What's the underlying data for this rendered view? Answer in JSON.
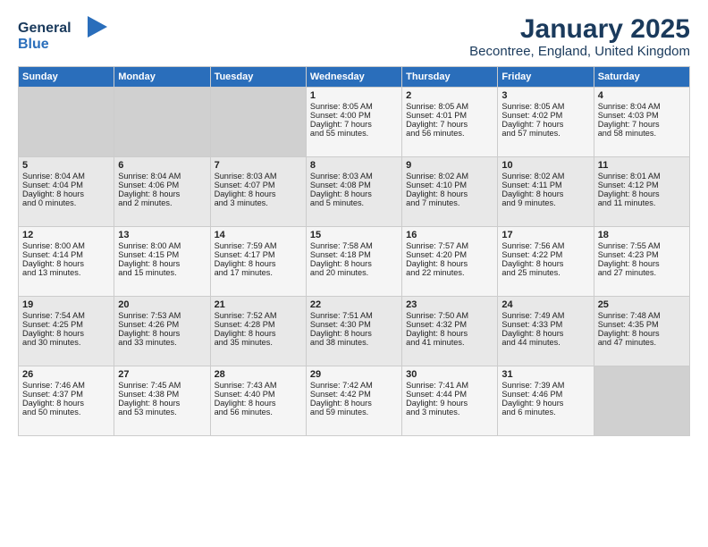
{
  "header": {
    "logo_line1": "General",
    "logo_line2": "Blue",
    "title": "January 2025",
    "subtitle": "Becontree, England, United Kingdom"
  },
  "days_of_week": [
    "Sunday",
    "Monday",
    "Tuesday",
    "Wednesday",
    "Thursday",
    "Friday",
    "Saturday"
  ],
  "weeks": [
    [
      {
        "day": "",
        "content": ""
      },
      {
        "day": "",
        "content": ""
      },
      {
        "day": "",
        "content": ""
      },
      {
        "day": "1",
        "content": "Sunrise: 8:05 AM\nSunset: 4:00 PM\nDaylight: 7 hours\nand 55 minutes."
      },
      {
        "day": "2",
        "content": "Sunrise: 8:05 AM\nSunset: 4:01 PM\nDaylight: 7 hours\nand 56 minutes."
      },
      {
        "day": "3",
        "content": "Sunrise: 8:05 AM\nSunset: 4:02 PM\nDaylight: 7 hours\nand 57 minutes."
      },
      {
        "day": "4",
        "content": "Sunrise: 8:04 AM\nSunset: 4:03 PM\nDaylight: 7 hours\nand 58 minutes."
      }
    ],
    [
      {
        "day": "5",
        "content": "Sunrise: 8:04 AM\nSunset: 4:04 PM\nDaylight: 8 hours\nand 0 minutes."
      },
      {
        "day": "6",
        "content": "Sunrise: 8:04 AM\nSunset: 4:06 PM\nDaylight: 8 hours\nand 2 minutes."
      },
      {
        "day": "7",
        "content": "Sunrise: 8:03 AM\nSunset: 4:07 PM\nDaylight: 8 hours\nand 3 minutes."
      },
      {
        "day": "8",
        "content": "Sunrise: 8:03 AM\nSunset: 4:08 PM\nDaylight: 8 hours\nand 5 minutes."
      },
      {
        "day": "9",
        "content": "Sunrise: 8:02 AM\nSunset: 4:10 PM\nDaylight: 8 hours\nand 7 minutes."
      },
      {
        "day": "10",
        "content": "Sunrise: 8:02 AM\nSunset: 4:11 PM\nDaylight: 8 hours\nand 9 minutes."
      },
      {
        "day": "11",
        "content": "Sunrise: 8:01 AM\nSunset: 4:12 PM\nDaylight: 8 hours\nand 11 minutes."
      }
    ],
    [
      {
        "day": "12",
        "content": "Sunrise: 8:00 AM\nSunset: 4:14 PM\nDaylight: 8 hours\nand 13 minutes."
      },
      {
        "day": "13",
        "content": "Sunrise: 8:00 AM\nSunset: 4:15 PM\nDaylight: 8 hours\nand 15 minutes."
      },
      {
        "day": "14",
        "content": "Sunrise: 7:59 AM\nSunset: 4:17 PM\nDaylight: 8 hours\nand 17 minutes."
      },
      {
        "day": "15",
        "content": "Sunrise: 7:58 AM\nSunset: 4:18 PM\nDaylight: 8 hours\nand 20 minutes."
      },
      {
        "day": "16",
        "content": "Sunrise: 7:57 AM\nSunset: 4:20 PM\nDaylight: 8 hours\nand 22 minutes."
      },
      {
        "day": "17",
        "content": "Sunrise: 7:56 AM\nSunset: 4:22 PM\nDaylight: 8 hours\nand 25 minutes."
      },
      {
        "day": "18",
        "content": "Sunrise: 7:55 AM\nSunset: 4:23 PM\nDaylight: 8 hours\nand 27 minutes."
      }
    ],
    [
      {
        "day": "19",
        "content": "Sunrise: 7:54 AM\nSunset: 4:25 PM\nDaylight: 8 hours\nand 30 minutes."
      },
      {
        "day": "20",
        "content": "Sunrise: 7:53 AM\nSunset: 4:26 PM\nDaylight: 8 hours\nand 33 minutes."
      },
      {
        "day": "21",
        "content": "Sunrise: 7:52 AM\nSunset: 4:28 PM\nDaylight: 8 hours\nand 35 minutes."
      },
      {
        "day": "22",
        "content": "Sunrise: 7:51 AM\nSunset: 4:30 PM\nDaylight: 8 hours\nand 38 minutes."
      },
      {
        "day": "23",
        "content": "Sunrise: 7:50 AM\nSunset: 4:32 PM\nDaylight: 8 hours\nand 41 minutes."
      },
      {
        "day": "24",
        "content": "Sunrise: 7:49 AM\nSunset: 4:33 PM\nDaylight: 8 hours\nand 44 minutes."
      },
      {
        "day": "25",
        "content": "Sunrise: 7:48 AM\nSunset: 4:35 PM\nDaylight: 8 hours\nand 47 minutes."
      }
    ],
    [
      {
        "day": "26",
        "content": "Sunrise: 7:46 AM\nSunset: 4:37 PM\nDaylight: 8 hours\nand 50 minutes."
      },
      {
        "day": "27",
        "content": "Sunrise: 7:45 AM\nSunset: 4:38 PM\nDaylight: 8 hours\nand 53 minutes."
      },
      {
        "day": "28",
        "content": "Sunrise: 7:43 AM\nSunset: 4:40 PM\nDaylight: 8 hours\nand 56 minutes."
      },
      {
        "day": "29",
        "content": "Sunrise: 7:42 AM\nSunset: 4:42 PM\nDaylight: 8 hours\nand 59 minutes."
      },
      {
        "day": "30",
        "content": "Sunrise: 7:41 AM\nSunset: 4:44 PM\nDaylight: 9 hours\nand 3 minutes."
      },
      {
        "day": "31",
        "content": "Sunrise: 7:39 AM\nSunset: 4:46 PM\nDaylight: 9 hours\nand 6 minutes."
      },
      {
        "day": "",
        "content": ""
      }
    ]
  ]
}
